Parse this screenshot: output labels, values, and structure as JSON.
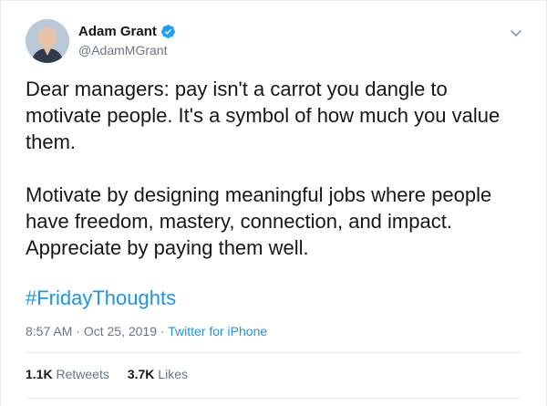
{
  "user": {
    "display_name": "Adam Grant",
    "handle": "@AdamMGrant",
    "verified": true
  },
  "tweet": {
    "text": "Dear managers: pay isn't a carrot you dangle to\nmotivate people. It's a symbol of how much you value\nthem.\n\nMotivate by designing meaningful jobs where people\nhave freedom, mastery, connection, and impact.\nAppreciate by paying them well.",
    "hashtag": "#FridayThoughts",
    "time": "8:57 AM",
    "date": "Oct 25, 2019",
    "separator": "·",
    "source": "Twitter for iPhone"
  },
  "stats": {
    "retweets_count": "1.1K",
    "retweets_label": "Retweets",
    "likes_count": "3.7K",
    "likes_label": "Likes"
  },
  "colors": {
    "link": "#1b95e0",
    "secondary_text": "#657786",
    "primary_text": "#14171a",
    "verified_badge": "#1da1f2"
  },
  "icons": {
    "verified": "verified-badge-icon",
    "more": "chevron-down-icon"
  }
}
